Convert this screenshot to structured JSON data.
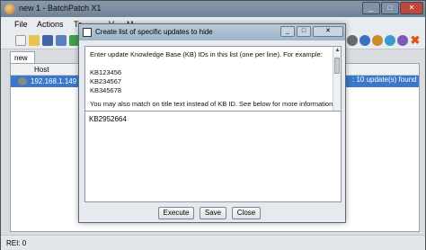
{
  "main": {
    "title": "new 1 - BatchPatch X1",
    "menus": [
      "File",
      "Actions",
      "To",
      "V",
      "M"
    ],
    "tab": "new 1",
    "grid": {
      "header_host": "Host",
      "row_host": "192.168.1.149",
      "row_status": ": 10 update(s) found"
    },
    "status": "REI: 0",
    "colors": {
      "selection": "#3b78c8",
      "window_bg": "#d9dde2"
    }
  },
  "dialog": {
    "title": "Create list of specific updates to hide",
    "instructions": {
      "line1": "Enter update Knowledge Base (KB) IDs in this list (one per line).  For example:",
      "examples": [
        "KB123456",
        "KB234567",
        "KB345678"
      ],
      "line2": "You may also match on title text instead of KB ID.  See below for more information."
    },
    "input_value": "KB2952664",
    "buttons": {
      "execute": "Execute",
      "save": "Save",
      "close": "Close"
    }
  }
}
